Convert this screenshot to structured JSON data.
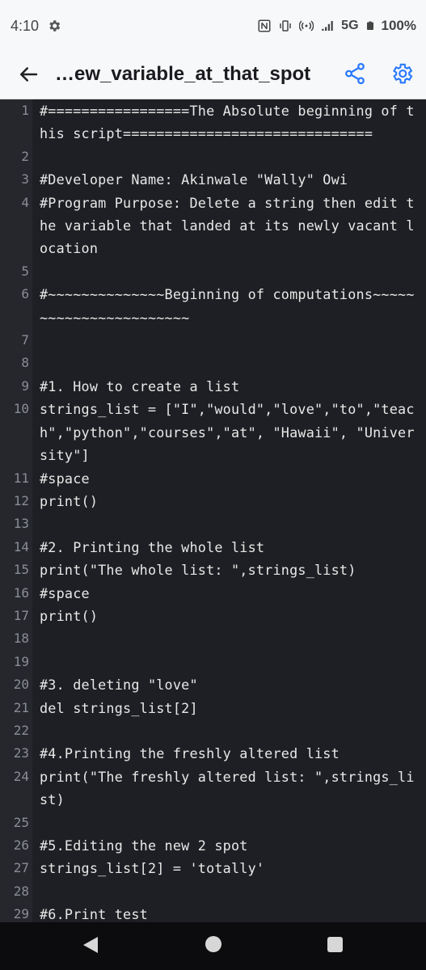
{
  "status_bar": {
    "time": "4:10",
    "battery": "100%",
    "network": "5G",
    "icons": [
      "gear-icon",
      "nfc-icon",
      "vibrate-icon",
      "hotspot-icon",
      "signal-icon",
      "battery-icon"
    ]
  },
  "app_bar": {
    "title": "…ew_variable_at_that_spot",
    "back_icon": "arrow-left-icon",
    "share_icon": "share-icon",
    "settings_icon": "gear-icon",
    "accent": "#2979ff"
  },
  "editor": {
    "lines": [
      {
        "num": "1",
        "text": "#=================The Absolute beginning of this script=============================="
      },
      {
        "num": "2",
        "text": ""
      },
      {
        "num": "3",
        "text": "#Developer Name: Akinwale \"Wally\" Owi"
      },
      {
        "num": "4",
        "text": "#Program Purpose: Delete a string then edit the variable that landed at its newly vacant location"
      },
      {
        "num": "5",
        "text": ""
      },
      {
        "num": "6",
        "text": "#~~~~~~~~~~~~~~Beginning of computations~~~~~~~~~~~~~~~~~~~~~~~"
      },
      {
        "num": "7",
        "text": ""
      },
      {
        "num": "8",
        "text": ""
      },
      {
        "num": "9",
        "text": "#1. How to create a list"
      },
      {
        "num": "10",
        "text": "strings_list = [\"I\",\"would\",\"love\",\"to\",\"teach\",\"python\",\"courses\",\"at\", \"Hawaii\", \"University\"]"
      },
      {
        "num": "11",
        "text": "#space"
      },
      {
        "num": "12",
        "text": "print()"
      },
      {
        "num": "13",
        "text": ""
      },
      {
        "num": "14",
        "text": "#2. Printing the whole list"
      },
      {
        "num": "15",
        "text": "print(\"The whole list: \",strings_list)"
      },
      {
        "num": "16",
        "text": "#space"
      },
      {
        "num": "17",
        "text": "print()"
      },
      {
        "num": "18",
        "text": ""
      },
      {
        "num": "19",
        "text": ""
      },
      {
        "num": "20",
        "text": "#3. deleting \"love\""
      },
      {
        "num": "21",
        "text": "del strings_list[2]"
      },
      {
        "num": "22",
        "text": ""
      },
      {
        "num": "23",
        "text": "#4.Printing the freshly altered list"
      },
      {
        "num": "24",
        "text": "print(\"The freshly altered list: \",strings_list)"
      },
      {
        "num": "25",
        "text": ""
      },
      {
        "num": "26",
        "text": "#5.Editing the new 2 spot"
      },
      {
        "num": "27",
        "text": "strings_list[2] = 'totally'"
      },
      {
        "num": "28",
        "text": ""
      },
      {
        "num": "29",
        "text": "#6.Print test"
      }
    ]
  },
  "nav_bar": {
    "icons": [
      "back-triangle-icon",
      "home-circle-icon",
      "recents-square-icon"
    ]
  }
}
